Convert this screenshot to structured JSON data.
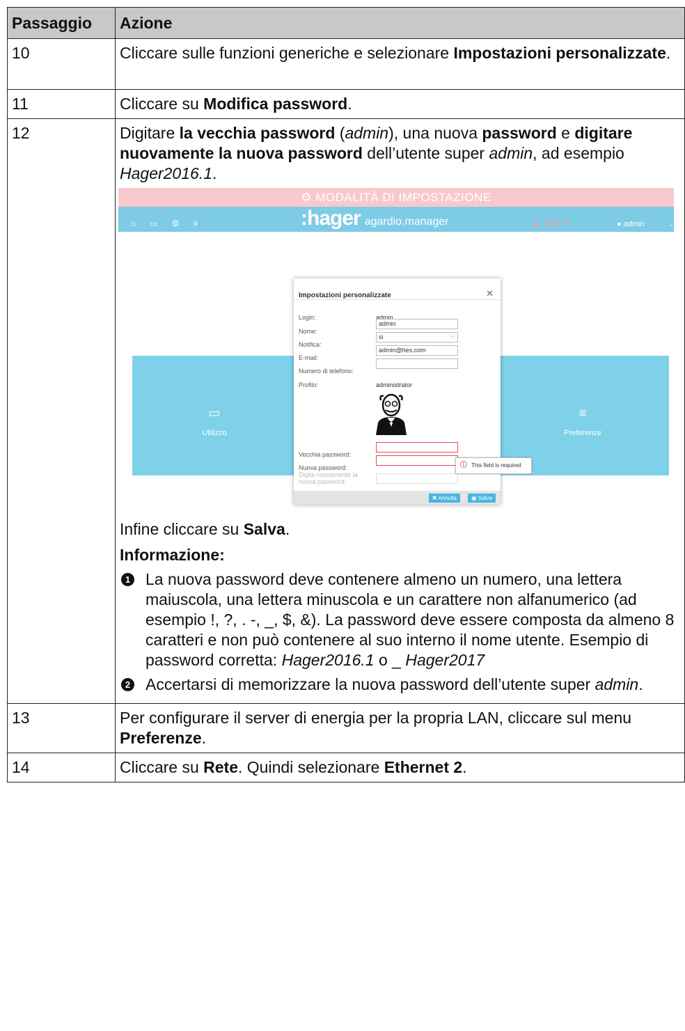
{
  "header": {
    "step": "Passaggio",
    "action": "Azione"
  },
  "rows": [
    {
      "step": "10",
      "before": "Cliccare sulle funzioni generiche e selezionare ",
      "bold": "Impostazioni personalizzate",
      "after": "."
    },
    {
      "step": "11",
      "before": "Cliccare su ",
      "bold": "Modifica password",
      "after": "."
    },
    {
      "step": "12",
      "t1": "Digitare ",
      "b1": "la vecchia password",
      "t2": " (",
      "i1": "admin",
      "t3": "), una nuova ",
      "b2": "password",
      "t4": " e ",
      "b3": "digitare nuovamente la nuova password",
      "t5": " dell’utente super ",
      "i2": "admin",
      "t6": ", ad esempio ",
      "i3": "Hager2016.1",
      "t7": ".",
      "final_before": "Infine cliccare su ",
      "final_bold": "Salva",
      "final_after": ".",
      "info_title": "Informazione:",
      "info": [
        {
          "num": "1",
          "text": "La nuova password deve contenere almeno un numero, una lettera maiuscola, una lettera minuscola e un carattere non alfanumerico (ad esempio !, ?, . -, _, $, &). La password deve essere composta da almeno 8 caratteri e non può contenere al suo interno il nome utente. Esempio di password corretta: ",
          "ex1": "Hager2016.1",
          "mid": " o _",
          "ex2": "Hager2017"
        },
        {
          "num": "2",
          "text": "Accertarsi di memorizzare la nuova password dell’utente super ",
          "ital": "admin",
          "end": "."
        }
      ]
    },
    {
      "step": "13",
      "before": "Per configurare il server di energia per la propria LAN, cliccare sul menu ",
      "bold": "Preferenze",
      "after": "."
    },
    {
      "step": "14",
      "t1": "Cliccare su ",
      "b1": "Rete",
      "t2": ". Quindi selezionare ",
      "b2": "Ethernet 2",
      "t3": "."
    }
  ],
  "screenshot": {
    "mode_bar": "MODALITÀ DI IMPOSTAZIONE",
    "brand": ":hager",
    "brand_sub": "agardio.manager",
    "alert_count": "1(0)",
    "user": "admin",
    "tile_left": "Utilizzo",
    "tile_right": "Preferenze",
    "dialog": {
      "title": "Impostazioni personalizzate",
      "login_label": "Login:",
      "login_value": "admin",
      "name_label": "Nome:",
      "name_value": "admin",
      "notify_label": "Notifica:",
      "notify_value": "si",
      "email_label": "E-mail:",
      "email_value": "admin@hes.com",
      "phone_label": "Numero di telefono:",
      "phone_value": "",
      "profile_label": "Profilo:",
      "profile_value": "administrator",
      "old_pw_label": "Vecchia password:",
      "new_pw_label": "Nuova password:",
      "repeat_pw_label": "Digita nuovamente la nuova password:",
      "tooltip": "This field is required",
      "cancel": "Annulla",
      "save": "Salva"
    }
  }
}
